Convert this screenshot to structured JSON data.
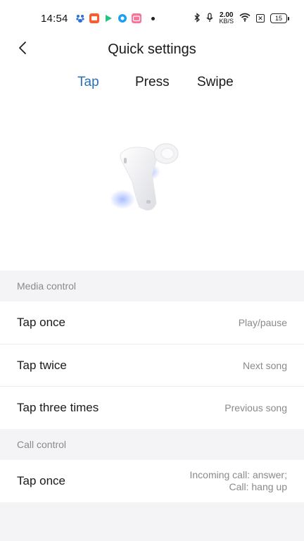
{
  "status_bar": {
    "time": "14:54",
    "net_speed_value": "2.00",
    "net_speed_unit": "KB/S",
    "battery": "15",
    "icons": [
      "baidu-icon",
      "taobao-icon",
      "video-icon",
      "qq-browser-icon",
      "bilibili-icon",
      "notification-dot",
      "bluetooth-icon",
      "microphone-icon",
      "wifi-icon",
      "no-sim-icon",
      "battery-icon"
    ]
  },
  "header": {
    "title": "Quick settings",
    "back_icon": "chevron-left-icon"
  },
  "tabs": [
    {
      "label": "Tap",
      "active": true
    },
    {
      "label": "Press",
      "active": false
    },
    {
      "label": "Swipe",
      "active": false
    }
  ],
  "accent_color": "#2c6eb8",
  "media_section": {
    "title": "Media control",
    "rows": [
      {
        "label": "Tap once",
        "value": "Play/pause"
      },
      {
        "label": "Tap twice",
        "value": "Next song"
      },
      {
        "label": "Tap three times",
        "value": "Previous song"
      }
    ]
  },
  "call_section": {
    "title": "Call control",
    "rows": [
      {
        "label": "Tap once",
        "value_line1": "Incoming call: answer;",
        "value_line2": "Call: hang up"
      }
    ]
  }
}
